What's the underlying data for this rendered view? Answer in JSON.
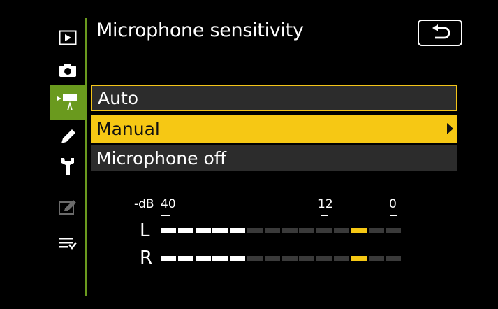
{
  "title": "Microphone sensitivity",
  "tabs": [
    {
      "name": "playback-menu",
      "icon": "playback-icon",
      "active": false
    },
    {
      "name": "photo-shooting-menu",
      "icon": "camera-icon",
      "active": false
    },
    {
      "name": "movie-shooting-menu",
      "icon": "movie-camera-icon",
      "active": true
    },
    {
      "name": "custom-settings-menu",
      "icon": "pencil-icon",
      "active": false
    },
    {
      "name": "setup-menu",
      "icon": "wrench-icon",
      "active": false
    },
    {
      "name": "retouch-menu",
      "icon": "retouch-icon",
      "active": false
    },
    {
      "name": "my-menu",
      "icon": "my-menu-icon",
      "active": false
    }
  ],
  "menu": {
    "items": [
      {
        "label": "Auto",
        "state": "focused"
      },
      {
        "label": "Manual",
        "state": "selected"
      },
      {
        "label": "Microphone off",
        "state": "normal"
      }
    ]
  },
  "meter": {
    "unit": "-dB",
    "scale": [
      "40",
      "12",
      "0"
    ],
    "channels": [
      {
        "label": "L",
        "level_segments": 5,
        "peak_segment": 11,
        "total_segments": 14
      },
      {
        "label": "R",
        "level_segments": 5,
        "peak_segment": 11,
        "total_segments": 14
      }
    ]
  },
  "colors": {
    "accent_yellow": "#f6c814",
    "rail_green": "#6a9a1e",
    "item_bg": "#2c2c2c"
  }
}
